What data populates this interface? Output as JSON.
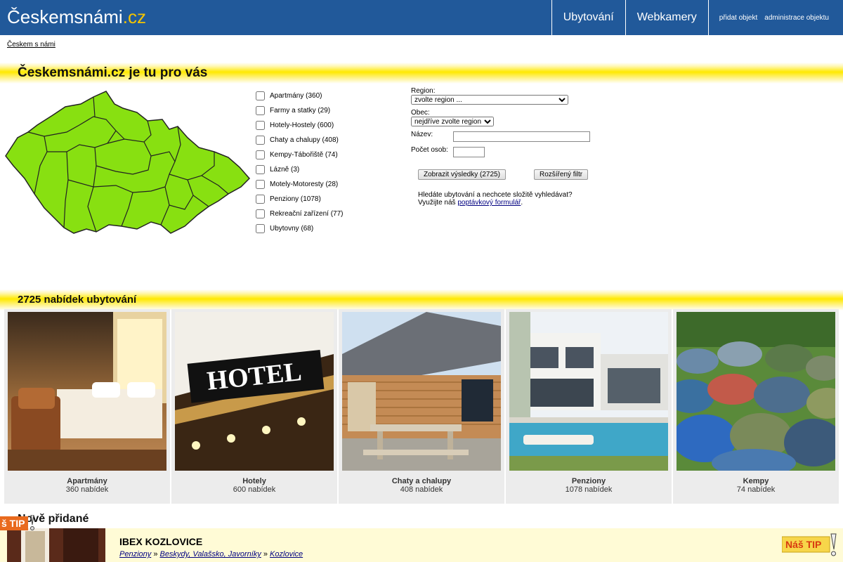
{
  "header": {
    "logo_main": "Českemsnámi",
    "logo_tld": ".cz",
    "nav": [
      "Ubytování",
      "Webkamery"
    ],
    "links": [
      "přidat objekt",
      "administrace objektu"
    ]
  },
  "breadcrumb": "Českem s námi",
  "hero": {
    "title": "Českemsnámi.cz je tu pro vás"
  },
  "filters": [
    "Apartmány (360)",
    "Farmy a statky (29)",
    "Hotely-Hostely (600)",
    "Chaty a chalupy (408)",
    "Kempy-Tábořiště (74)",
    "Lázně (3)",
    "Motely-Motoresty (28)",
    "Penziony (1078)",
    "Rekreační zařízení (77)",
    "Ubytovny (68)"
  ],
  "search": {
    "region_label": "Region:",
    "region_value": "zvolte region ...",
    "obec_label": "Obec:",
    "obec_value": "nejdříve zvolte region",
    "name_label": "Název:",
    "persons_label": "Počet osob:",
    "submit_label": "Zobrazit výsledky (2725)",
    "advanced_label": "Rozšířený filtr",
    "hint_line1": "Hledáte ubytování a nechcete složitě vyhledávat?",
    "hint_line2_prefix": "Využijte náš ",
    "hint_link": "poptávkový formulář",
    "hint_suffix": "."
  },
  "offers": {
    "title": "2725 nabídek ubytování"
  },
  "categories": [
    {
      "name": "Apartmány",
      "count": "360 nabídek"
    },
    {
      "name": "Hotely",
      "count": "600 nabídek"
    },
    {
      "name": "Chaty a chalupy",
      "count": "408 nabídek"
    },
    {
      "name": "Penziony",
      "count": "1078 nabídek"
    },
    {
      "name": "Kempy",
      "count": "74 nabídek"
    }
  ],
  "newly": {
    "title": "Nově přidané",
    "tip_left": "š TIP",
    "tip_right": "Náš TIP",
    "hotel_sign": "HOTEL",
    "listing": {
      "name": "IBEX KOZLOVICE",
      "crumbs": [
        "Penziony",
        "Beskydy, Valašsko, Javorníky",
        "Kozlovice"
      ],
      "sep": "»"
    }
  }
}
